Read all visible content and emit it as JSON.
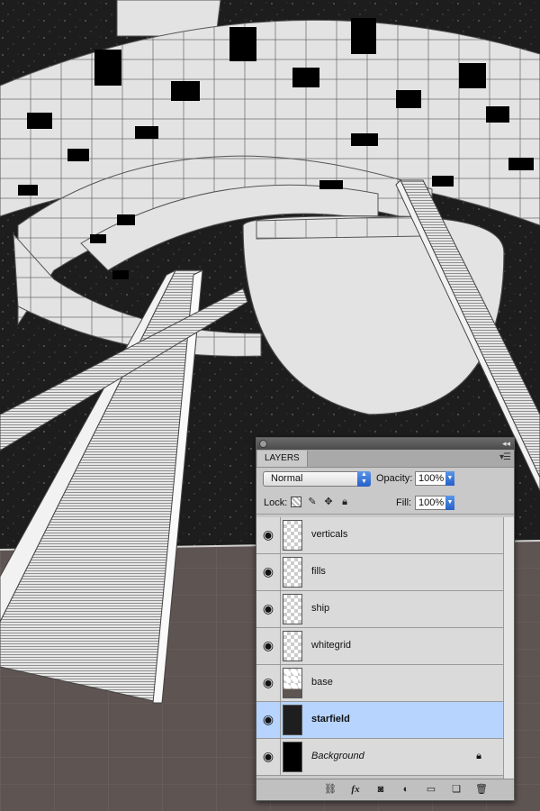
{
  "panel": {
    "tab_label": "LAYERS",
    "blend_mode": "Normal",
    "opacity_label": "Opacity:",
    "opacity_value": "100%",
    "lock_label": "Lock:",
    "fill_label": "Fill:",
    "fill_value": "100%",
    "layers": [
      {
        "name": "verticals",
        "thumb": "transparent",
        "selected": false,
        "visible": true
      },
      {
        "name": "fills",
        "thumb": "transparent",
        "selected": false,
        "visible": true
      },
      {
        "name": "ship",
        "thumb": "transparent",
        "selected": false,
        "visible": true
      },
      {
        "name": "whitegrid",
        "thumb": "transparent",
        "selected": false,
        "visible": true
      },
      {
        "name": "base",
        "thumb": "base",
        "selected": false,
        "visible": true
      },
      {
        "name": "starfield",
        "thumb": "dark",
        "selected": true,
        "visible": true
      },
      {
        "name": "Background",
        "thumb": "black",
        "selected": false,
        "visible": true,
        "locked": true
      }
    ],
    "footer_icons": [
      "link-layers-icon",
      "fx-icon",
      "mask-icon",
      "adjustment-icon",
      "folder-icon",
      "new-layer-icon",
      "trash-icon"
    ]
  },
  "colors": {
    "selection": "#b6d4fe",
    "panel_bg": "#c9c9c9",
    "accent_blue": "#2f6fd6",
    "ground": "#5e5452",
    "space": "#1a1a1a"
  }
}
